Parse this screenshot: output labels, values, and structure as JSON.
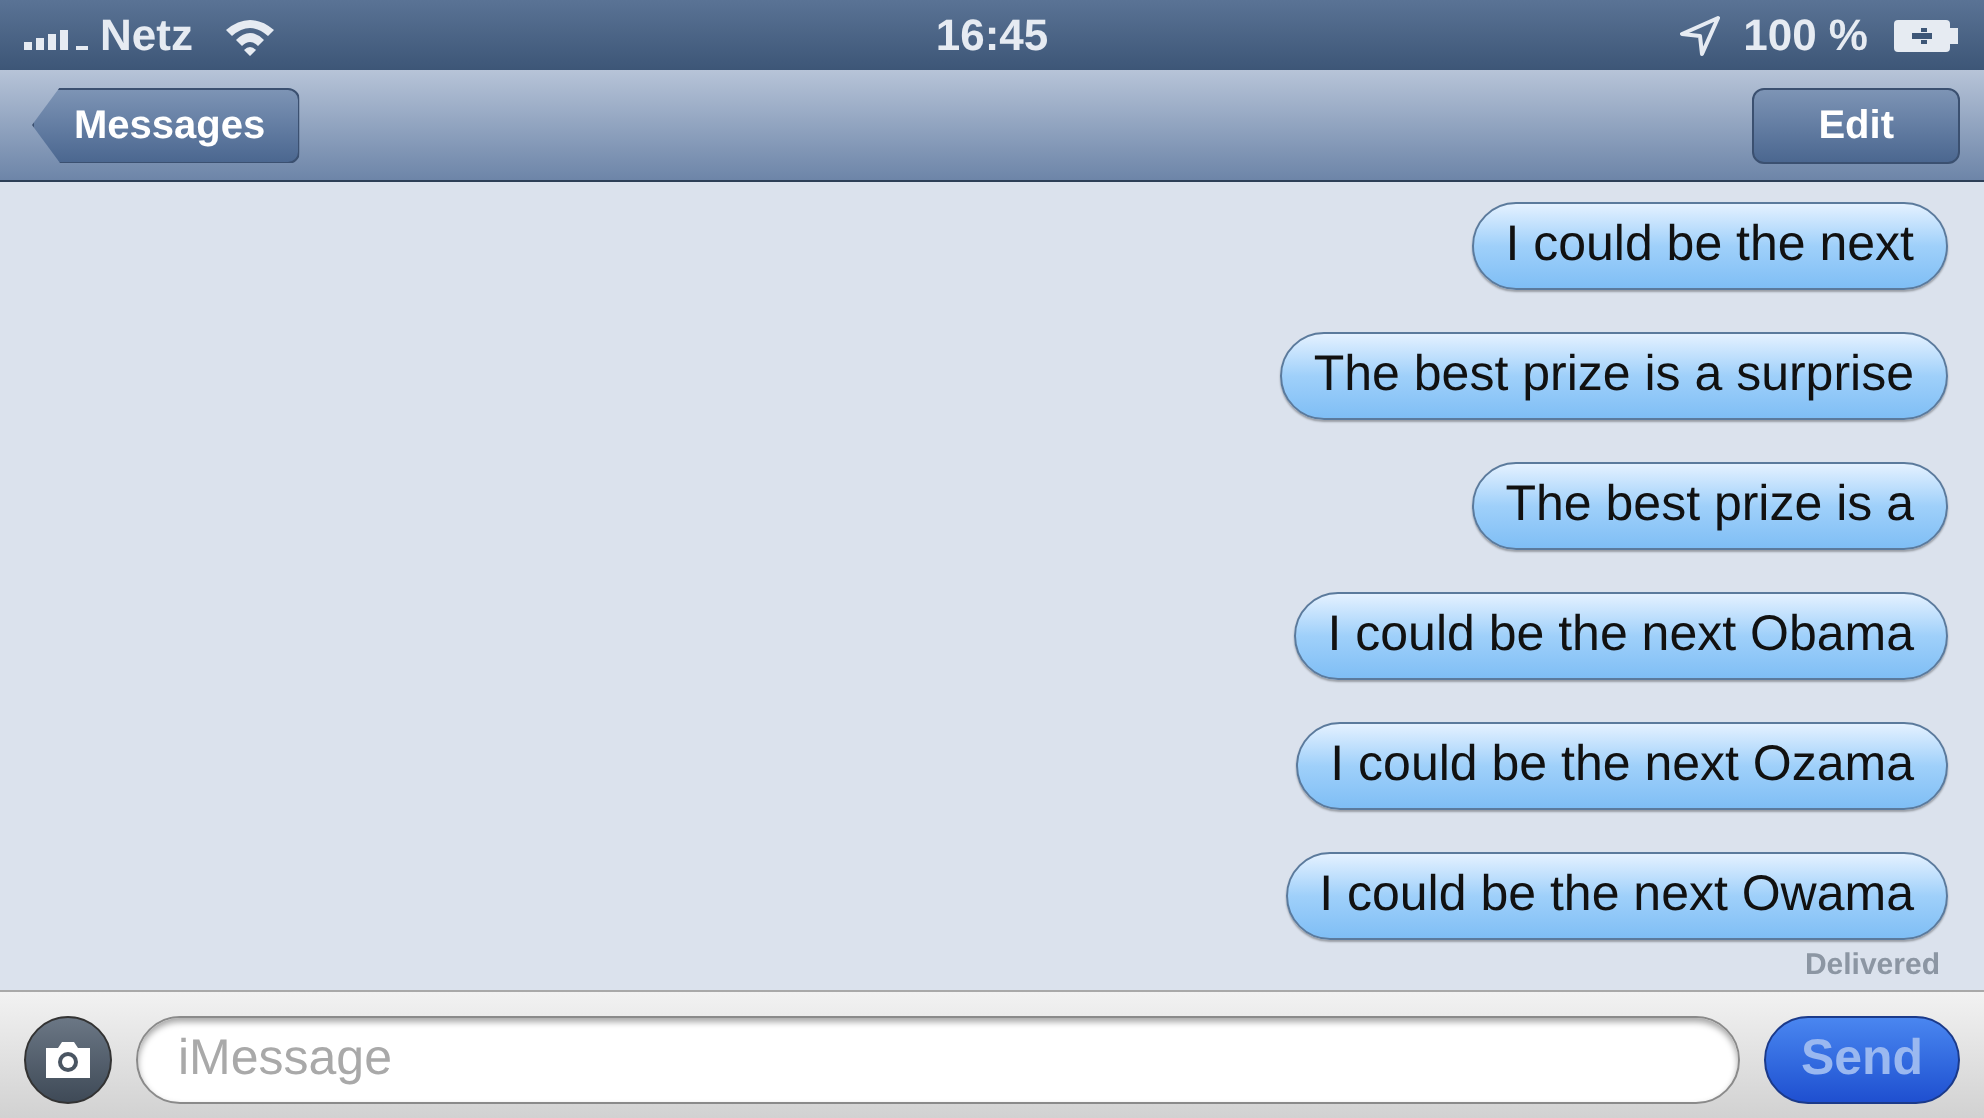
{
  "status_bar": {
    "carrier": "Netz",
    "time": "16:45",
    "battery": "100 %"
  },
  "nav_bar": {
    "back": "Messages",
    "action": "Edit"
  },
  "messages": [
    {
      "text": "I could be the next"
    },
    {
      "text": "The best prize is a surprise"
    },
    {
      "text": "The best prize is a"
    },
    {
      "text": "I could be the next Obama"
    },
    {
      "text": "I could be the next Ozama"
    },
    {
      "text": "I could be the next Owama"
    }
  ],
  "delivery_status": "Delivered",
  "composer": {
    "placeholder": "iMessage",
    "send": {
      "label": "Send",
      "disabled": true
    }
  }
}
